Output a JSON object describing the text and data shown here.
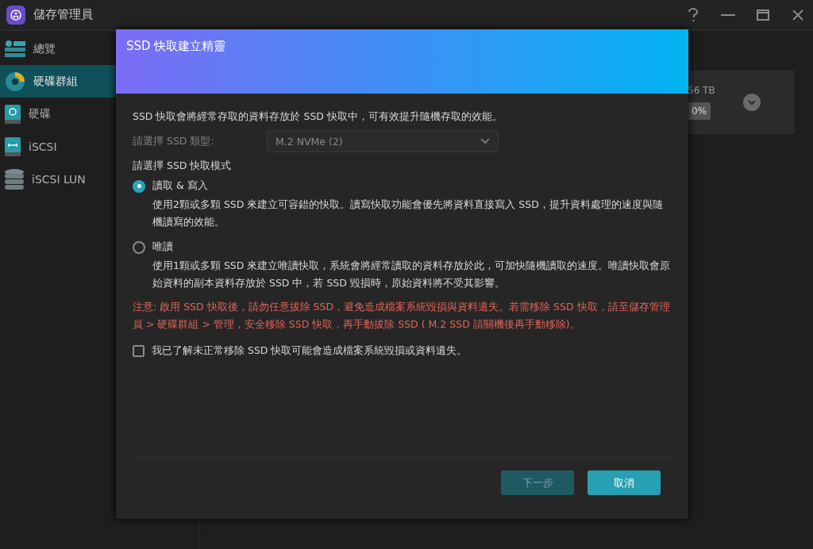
{
  "window": {
    "title": "儲存管理員"
  },
  "sidebar": {
    "items": [
      {
        "label": "總覽",
        "kind": "overview",
        "selected": false
      },
      {
        "label": "硬碟群組",
        "kind": "pool",
        "selected": true
      },
      {
        "label": "硬碟",
        "kind": "disk",
        "selected": false
      },
      {
        "label": "iSCSI",
        "kind": "iscsi",
        "selected": false
      },
      {
        "label": "iSCSI LUN",
        "kind": "lun",
        "selected": false
      }
    ]
  },
  "card": {
    "capacity": "56 TB",
    "usage": "0%"
  },
  "dialog": {
    "title": "SSD 快取建立精靈",
    "intro": "SSD 快取會將經常存取的資料存放於 SSD 快取中，可有效提升隨機存取的效能。",
    "ssd_type": {
      "label": "請選擇 SSD 類型:",
      "value": "M.2 NVMe (2)",
      "disabled": true
    },
    "mode_label": "請選擇 SSD 快取模式",
    "modes": [
      {
        "label": "讀取 & 寫入",
        "selected": true,
        "description": "使用2顆或多顆 SSD 來建立可容錯的快取。讀寫快取功能會優先將資料直接寫入 SSD，提升資料處理的速度與隨機讀寫的效能。"
      },
      {
        "label": "唯讀",
        "selected": false,
        "description": "使用1顆或多顆 SSD 來建立唯讀快取，系統會將經常讀取的資料存放於此，可加快隨機讀取的速度。唯讀快取會原始資料的副本資料存放於 SSD 中，若 SSD 毀損時，原始資料將不受其影響。"
      }
    ],
    "warning": "注意: 啟用 SSD 快取後，請勿任意拔除 SSD，避免造成檔案系統毀損與資料遺失。若需移除 SSD 快取，請至儲存管理員 > 硬碟群組 > 管理，安全移除 SSD 快取，再手動拔除 SSD ( M.2 SSD 請關機後再手動移除)。",
    "acknowledge": {
      "label": "我已了解未正常移除 SSD 快取可能會造成檔案系統毀損或資料遺失。",
      "checked": false
    },
    "buttons": [
      {
        "label": "下一步",
        "disabled": true
      },
      {
        "label": "取消",
        "disabled": false
      }
    ]
  }
}
